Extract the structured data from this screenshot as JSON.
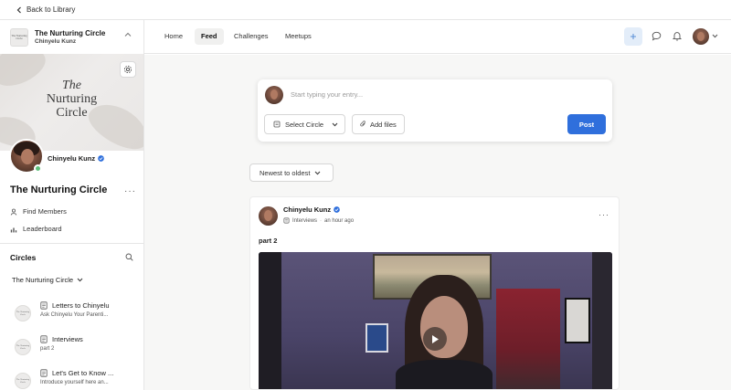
{
  "topbar": {
    "back_label": "Back to Library"
  },
  "community": {
    "logo_text": "The Nurturing Circle",
    "name": "The Nurturing Circle",
    "owner": "Chinyelu Kunz"
  },
  "banner": {
    "title_line1": "The",
    "title_line2": "Nurturing",
    "title_line3": "Circle"
  },
  "profile": {
    "name": "Chinyelu Kunz",
    "verified": true,
    "status": "online"
  },
  "sidebar": {
    "title": "The Nurturing Circle",
    "more_icon": "more-horizontal-icon",
    "links": [
      {
        "label": "Find Members",
        "icon": "person-icon"
      },
      {
        "label": "Leaderboard",
        "icon": "bar-chart-icon"
      }
    ],
    "circles_heading": "Circles",
    "circle_select": "The Nurturing Circle",
    "circles": [
      {
        "title": "Letters to Chinyelu",
        "subtitle": "Ask Chinyelu Your Parenti..."
      },
      {
        "title": "Interviews",
        "subtitle": "part 2"
      },
      {
        "title": "Let's Get to Know ...",
        "subtitle": "Introduce yourself here an..."
      }
    ]
  },
  "nav": {
    "tabs": [
      {
        "label": "Home",
        "active": false
      },
      {
        "label": "Feed",
        "active": true
      },
      {
        "label": "Challenges",
        "active": false
      },
      {
        "label": "Meetups",
        "active": false
      }
    ],
    "icons": [
      "plus-icon",
      "chat-icon",
      "bell-icon",
      "avatar",
      "chevron-down-icon"
    ]
  },
  "composer": {
    "placeholder": "Start typing your entry...",
    "value": "",
    "select_circle": "Select Circle",
    "add_files": "Add files",
    "post": "Post"
  },
  "sort": {
    "label": "Newest to oldest"
  },
  "post": {
    "author": "Chinyelu Kunz",
    "verified": true,
    "circle": "Interviews",
    "separator": "·",
    "time": "an hour ago",
    "body": "part 2",
    "media": "video"
  },
  "colors": {
    "accent": "#2f6fdc",
    "online": "#5dbf7a",
    "verified": "#2f6fdc",
    "feed_bg": "#f7f7f6"
  }
}
